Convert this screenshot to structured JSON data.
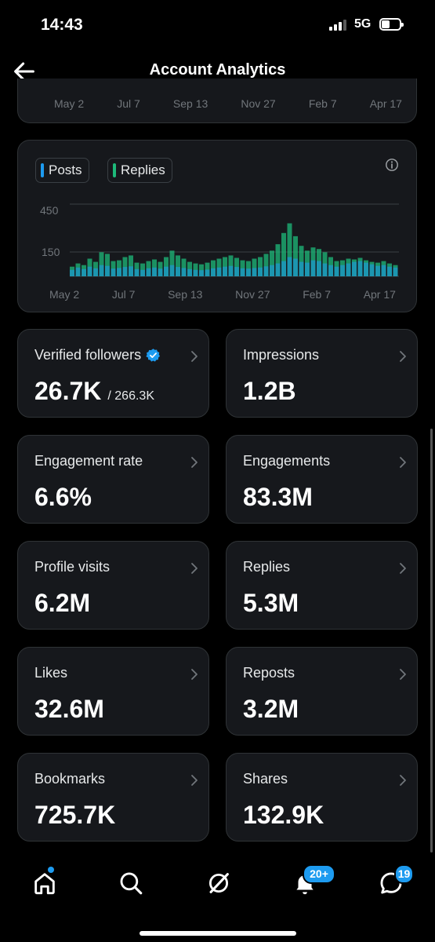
{
  "status_bar": {
    "time": "14:43",
    "network": "5G"
  },
  "header": {
    "title": "Account Analytics"
  },
  "top_chart": {
    "x_labels": [
      "May 2",
      "Jul 7",
      "Sep 13",
      "Nov 27",
      "Feb 7",
      "Apr 17"
    ]
  },
  "chart_data": {
    "type": "bar",
    "legend": [
      "Posts",
      "Replies"
    ],
    "y_ticks": [
      "450",
      "150"
    ],
    "x_labels": [
      "May 2",
      "Jul 7",
      "Sep 13",
      "Nov 27",
      "Feb 7",
      "Apr 17"
    ],
    "ylim": [
      0,
      500
    ],
    "grid": true,
    "series": [
      {
        "name": "Posts",
        "color": "#1d9bf0",
        "values": [
          40,
          55,
          45,
          60,
          50,
          70,
          65,
          48,
          52,
          58,
          62,
          45,
          40,
          50,
          55,
          48,
          60,
          70,
          58,
          52,
          45,
          40,
          38,
          42,
          50,
          55,
          60,
          65,
          58,
          50,
          48,
          52,
          55,
          62,
          70,
          80,
          95,
          120,
          110,
          90,
          85,
          100,
          95,
          80,
          70,
          60,
          70,
          80,
          90,
          95,
          85,
          75,
          65,
          70,
          60,
          55
        ]
      },
      {
        "name": "Replies",
        "color": "#1db97a",
        "values": [
          60,
          80,
          70,
          110,
          90,
          150,
          140,
          95,
          100,
          120,
          130,
          85,
          80,
          95,
          105,
          90,
          120,
          160,
          130,
          110,
          90,
          80,
          75,
          85,
          100,
          110,
          120,
          130,
          115,
          100,
          95,
          110,
          120,
          140,
          160,
          200,
          270,
          330,
          250,
          190,
          160,
          180,
          170,
          150,
          120,
          95,
          100,
          110,
          105,
          115,
          100,
          90,
          85,
          95,
          80,
          70
        ]
      }
    ]
  },
  "stats": [
    {
      "label": "Verified followers",
      "value": "26.7K",
      "sub": "/ 266.3K"
    },
    {
      "label": "Impressions",
      "value": "1.2B"
    },
    {
      "label": "Engagement rate",
      "value": "6.6%"
    },
    {
      "label": "Engagements",
      "value": "83.3M"
    },
    {
      "label": "Profile visits",
      "value": "6.2M"
    },
    {
      "label": "Replies",
      "value": "5.3M"
    },
    {
      "label": "Likes",
      "value": "32.6M"
    },
    {
      "label": "Reposts",
      "value": "3.2M"
    },
    {
      "label": "Bookmarks",
      "value": "725.7K"
    },
    {
      "label": "Shares",
      "value": "132.9K"
    }
  ],
  "tab_bar": {
    "notifications_badge": "20+",
    "messages_badge": "19"
  },
  "icons": {
    "back": "arrow-left-icon",
    "info": "info-icon",
    "chevron": "chevron-right-icon",
    "verified": "verified-badge-icon",
    "home": "home-icon",
    "search": "search-icon",
    "grok": "grok-icon",
    "notifications": "bell-icon",
    "messages": "messages-icon"
  },
  "colors": {
    "accent": "#1d9bf0",
    "replies": "#1db97a",
    "card": "#16181c",
    "border": "#2f3336"
  }
}
